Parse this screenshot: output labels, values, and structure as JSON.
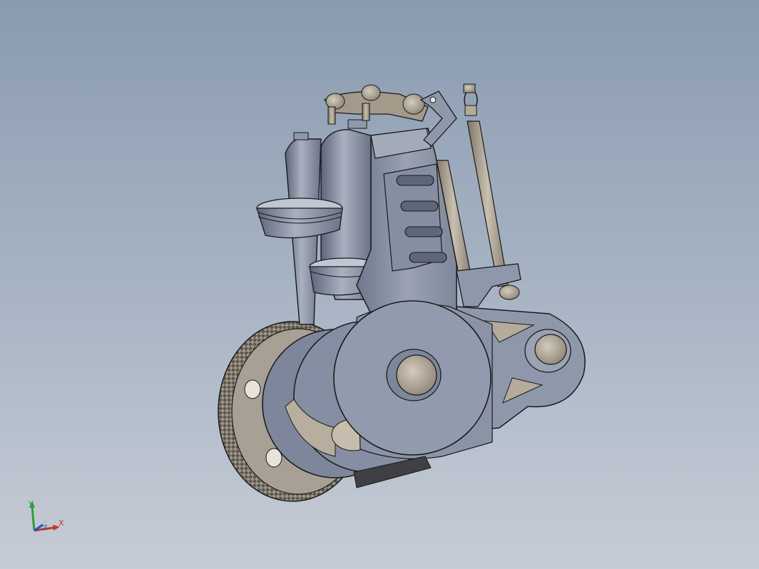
{
  "triad": {
    "x_label": "X",
    "y_label": "Y",
    "z_label": "Z",
    "colors": {
      "x": "#c0392b",
      "y": "#2e9c3c",
      "z": "#2850b8"
    }
  },
  "model": {
    "component_names": [
      "engine-block-icon",
      "cylinder-icon",
      "piston-icon",
      "cooling-fins-icon",
      "rocker-arm-icon",
      "pushrod-icon",
      "crank-disc-icon",
      "flywheel-gear-icon",
      "cam-housing-icon"
    ],
    "shading_color": "#8e96a8",
    "edge_color": "#1a1a1a"
  }
}
